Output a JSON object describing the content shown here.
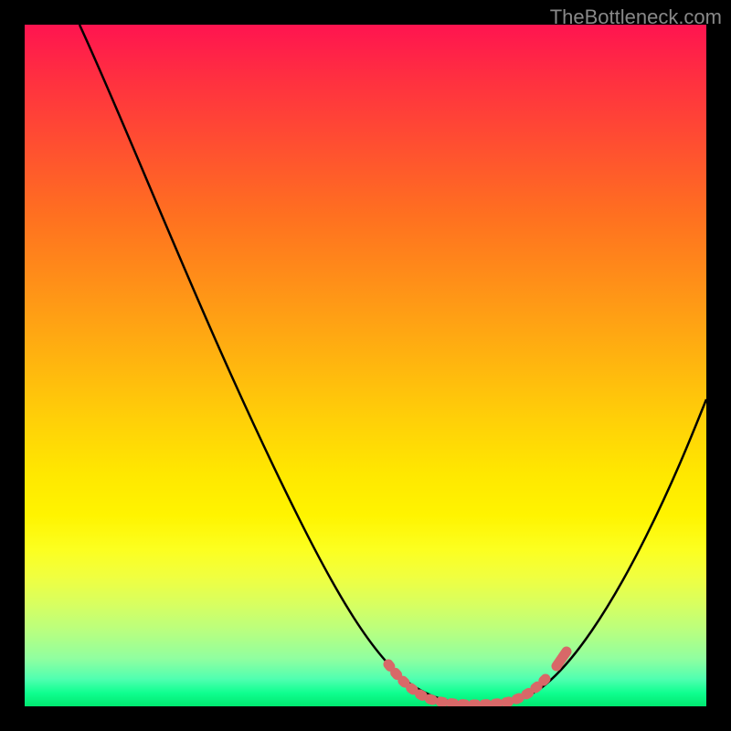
{
  "watermark": "TheBottleneck.com",
  "chart_data": {
    "type": "line",
    "title": "",
    "xlabel": "",
    "ylabel": "",
    "xlim": [
      0,
      100
    ],
    "ylim": [
      0,
      100
    ],
    "series": [
      {
        "name": "bottleneck-curve",
        "x": [
          10,
          15,
          20,
          25,
          30,
          35,
          40,
          45,
          50,
          53,
          56,
          59,
          62,
          65,
          68,
          71,
          74,
          78,
          82,
          86,
          90,
          94,
          98
        ],
        "y": [
          100,
          91,
          82,
          73,
          64,
          55,
          46,
          37,
          27,
          18,
          11,
          6,
          3,
          1,
          0,
          0,
          1,
          3,
          8,
          15,
          24,
          34,
          45
        ]
      }
    ],
    "annotations": [
      {
        "name": "valley-highlight",
        "x_range": [
          56,
          75
        ],
        "color": "#d86868"
      }
    ],
    "background": "rainbow-heat-gradient"
  },
  "colors": {
    "curve": "#000000",
    "highlight": "#d86868",
    "frame": "#000000"
  }
}
